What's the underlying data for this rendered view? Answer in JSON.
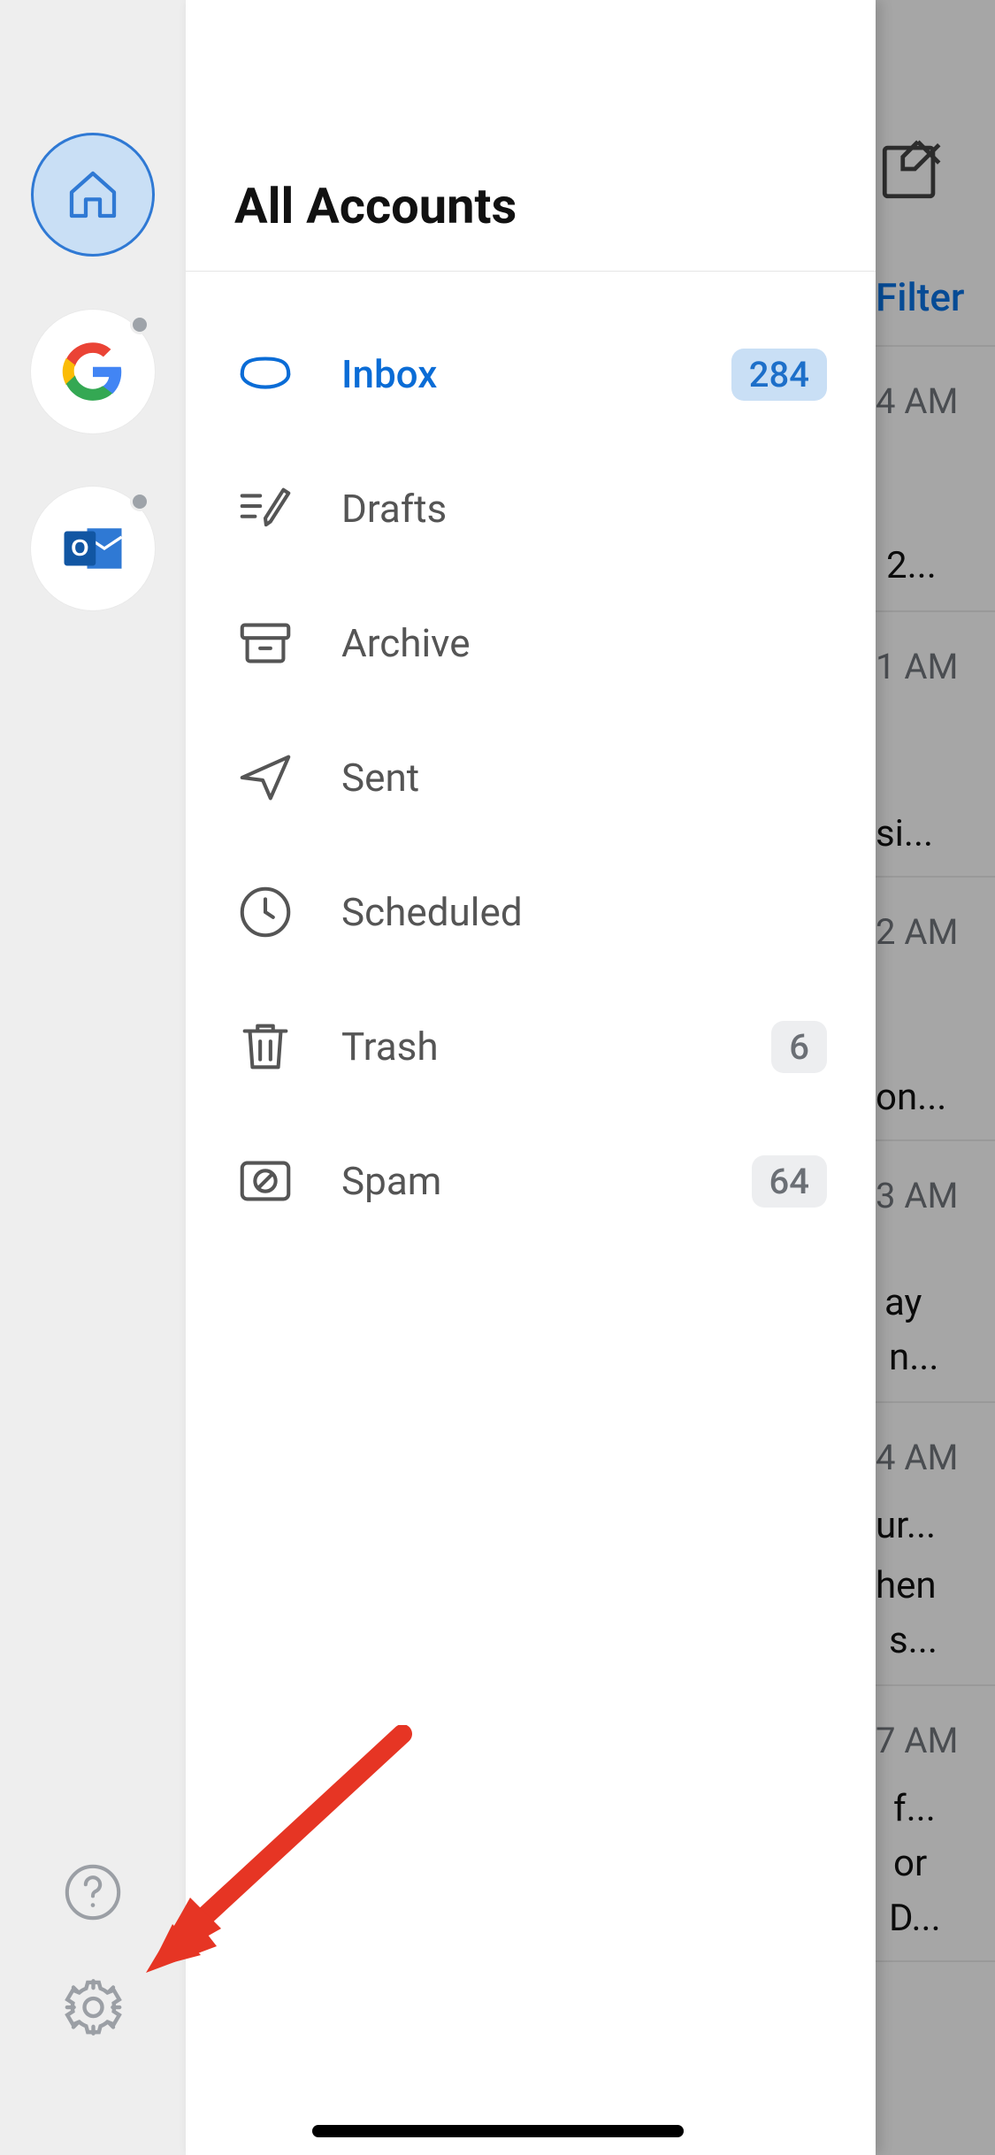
{
  "header": {
    "title": "All Accounts"
  },
  "folders": [
    {
      "key": "inbox",
      "label": "Inbox",
      "count": "284",
      "selected": true
    },
    {
      "key": "drafts",
      "label": "Drafts",
      "count": null,
      "selected": false
    },
    {
      "key": "archive",
      "label": "Archive",
      "count": null,
      "selected": false
    },
    {
      "key": "sent",
      "label": "Sent",
      "count": null,
      "selected": false
    },
    {
      "key": "scheduled",
      "label": "Scheduled",
      "count": null,
      "selected": false
    },
    {
      "key": "trash",
      "label": "Trash",
      "count": "6",
      "selected": false
    },
    {
      "key": "spam",
      "label": "Spam",
      "count": "64",
      "selected": false
    }
  ],
  "background": {
    "filter_label": "Filter",
    "rows": [
      {
        "time": "4 AM"
      },
      {
        "text": "2..."
      },
      {
        "time": "1 AM"
      },
      {
        "text": "si..."
      },
      {
        "time": "2 AM"
      },
      {
        "text": "on..."
      },
      {
        "time": "3 AM"
      },
      {
        "text": "ay"
      },
      {
        "text2": "n..."
      },
      {
        "time": "4 AM"
      },
      {
        "text": "ur..."
      },
      {
        "text2": "hen"
      },
      {
        "text3": "s..."
      },
      {
        "time": "7 AM"
      },
      {
        "text": "f..."
      },
      {
        "text2": "or"
      },
      {
        "text3": "D..."
      }
    ]
  },
  "annotation": {
    "type": "arrow",
    "target": "settings-button"
  },
  "colors": {
    "accent": "#0a6cd6",
    "selected_bg": "#c9dff5",
    "rail_bg": "#eeeeee",
    "arrow": "#e63524"
  }
}
